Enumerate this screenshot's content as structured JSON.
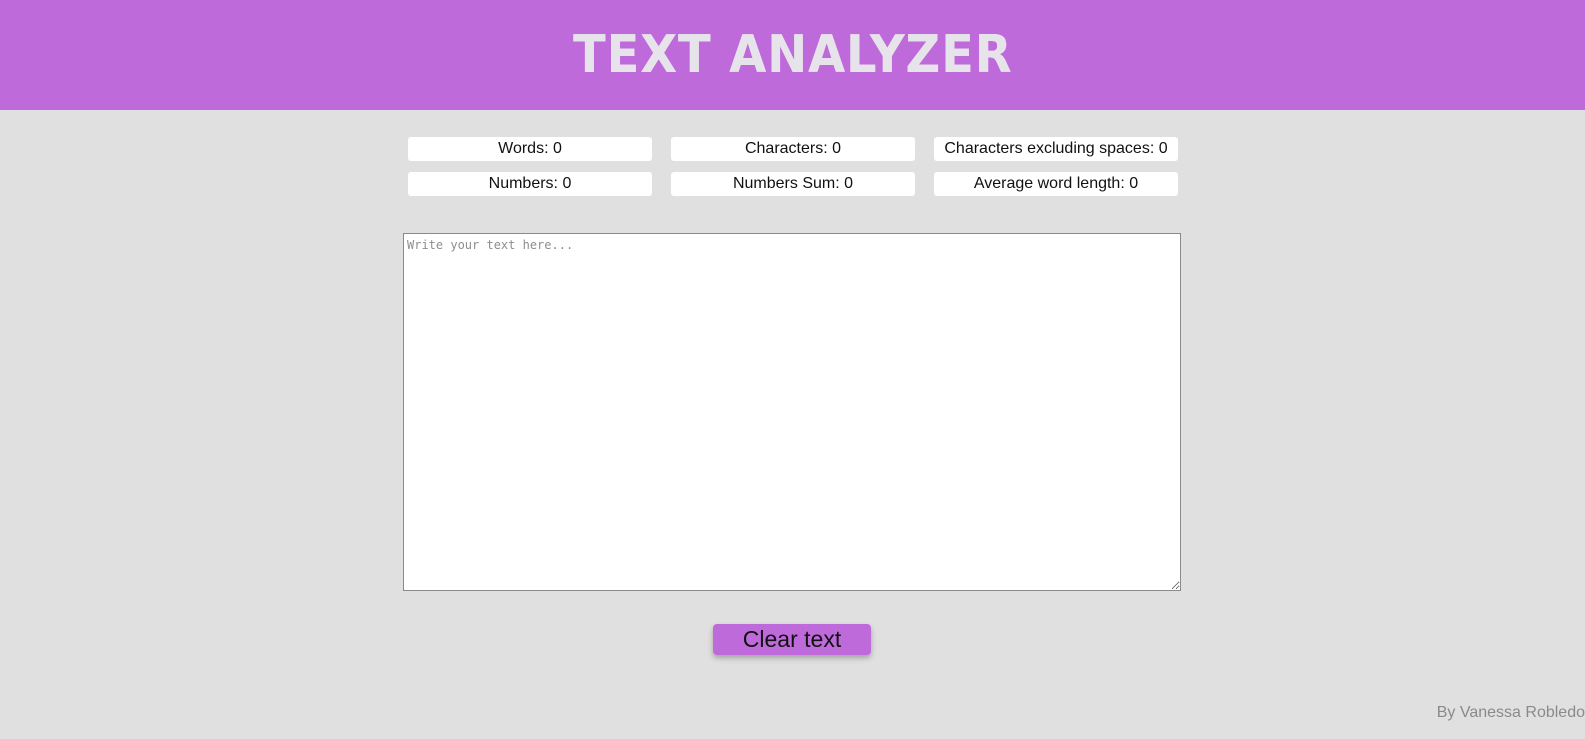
{
  "header": {
    "title": "TEXT ANALYZER"
  },
  "stats": {
    "words": "Words: 0",
    "characters": "Characters: 0",
    "characters_no_spaces": "Characters excluding spaces: 0",
    "numbers": "Numbers: 0",
    "numbers_sum": "Numbers Sum: 0",
    "avg_word_length": "Average word length: 0"
  },
  "editor": {
    "placeholder": "Write your text here...",
    "value": ""
  },
  "actions": {
    "clear_label": "Clear text"
  },
  "footer": {
    "credit": "By Vanessa Robledo"
  },
  "colors": {
    "accent": "#bf6adb",
    "background": "#e0e0e0",
    "title": "#e6e3ea"
  }
}
